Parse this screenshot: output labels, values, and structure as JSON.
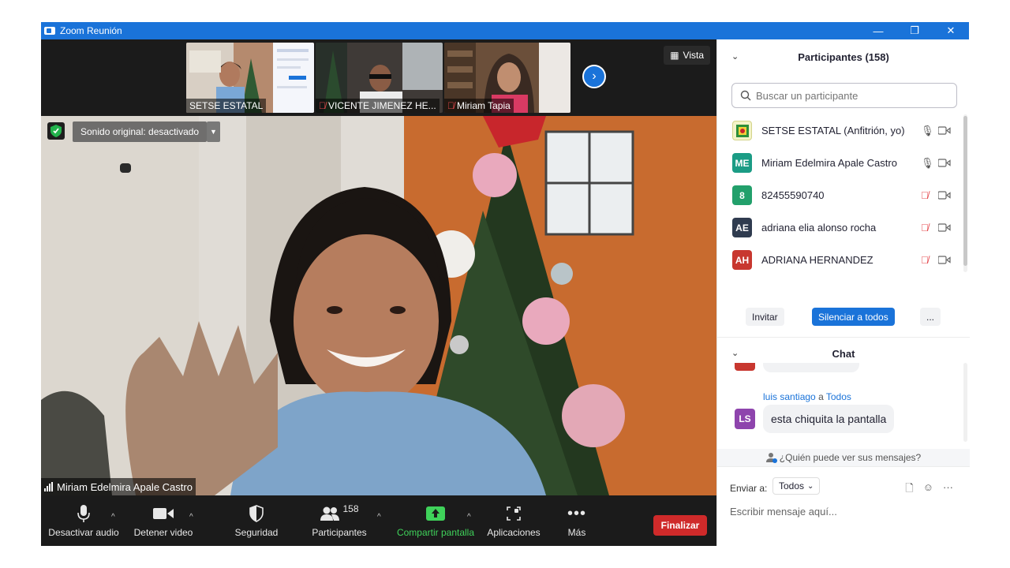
{
  "window": {
    "title": "Zoom Reunión",
    "minimize": "—",
    "restore": "❐",
    "close": "✕"
  },
  "gallery": {
    "thumbnails": [
      {
        "name": "SETSE ESTATAL",
        "muted": false
      },
      {
        "name": "VICENTE JIMENEZ HE...",
        "muted": true
      },
      {
        "name": "Miriam Tapia",
        "muted": true
      }
    ],
    "view_label": "Vista"
  },
  "main_video": {
    "audio_status": "Sonido original: desactivado",
    "speaker_name": "Miriam Edelmira Apale Castro"
  },
  "toolbar": {
    "mute_audio": "Desactivar audio",
    "stop_video": "Detener video",
    "security": "Seguridad",
    "participants": "Participantes",
    "participants_count": "158",
    "share_screen": "Compartir pantalla",
    "apps": "Aplicaciones",
    "more": "Más",
    "end": "Finalizar"
  },
  "participants_panel": {
    "title": "Participantes (158)",
    "search_placeholder": "Buscar un participante",
    "list": [
      {
        "initials": "",
        "name": "SETSE ESTATAL (Anfitrión, yo)",
        "color": "#f3f3c8",
        "mic_muted": false
      },
      {
        "initials": "ME",
        "name": "Miriam Edelmira Apale Castro",
        "color": "#1b9c85",
        "mic_muted": false
      },
      {
        "initials": "8",
        "name": "82455590740",
        "color": "#22a06b",
        "mic_muted": true
      },
      {
        "initials": "AE",
        "name": "adriana elia alonso rocha",
        "color": "#2f3b4f",
        "mic_muted": true
      },
      {
        "initials": "AH",
        "name": "ADRIANA HERNANDEZ",
        "color": "#c8372f",
        "mic_muted": true
      }
    ],
    "invite": "Invitar",
    "mute_all": "Silenciar a todos",
    "more": "..."
  },
  "chat_panel": {
    "title": "Chat",
    "messages": [
      {
        "sender": "luis santiago",
        "to_word": "a",
        "recipient": "Todos",
        "initials": "LS",
        "color": "#8e44ad",
        "text": "esta chiquita la pantalla"
      }
    ],
    "who_can_see": "¿Quién puede ver sus mensajes?",
    "send_to_label": "Enviar a:",
    "send_to_value": "Todos",
    "input_placeholder": "Escribir mensaje aquí..."
  },
  "colors": {
    "zoom_blue": "#1a73d9",
    "end_red": "#cf2a2a",
    "share_green": "#3fd25a",
    "mute_red": "#e5484d"
  }
}
